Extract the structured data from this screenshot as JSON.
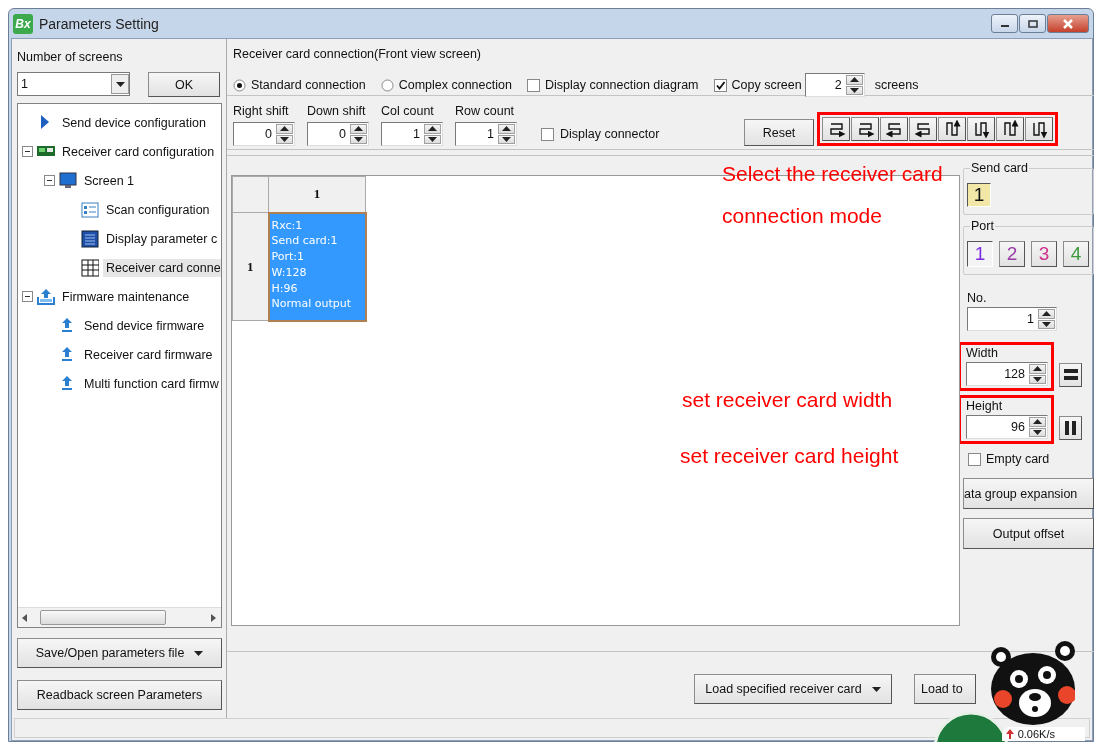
{
  "window": {
    "title": "Parameters Setting",
    "logo_text": "Bx"
  },
  "left_panel": {
    "screens_label": "Number of screens",
    "screens_value": "1",
    "ok_button": "OK",
    "tree": [
      {
        "kind": "send",
        "label": "Send device configuration",
        "selected": false
      },
      {
        "kind": "card",
        "label": "Receiver card configuration",
        "selected": false,
        "expanded": true,
        "children": [
          {
            "kind": "screen",
            "label": "Screen 1",
            "selected": false,
            "expanded": true,
            "children": [
              {
                "kind": "scan",
                "label": "Scan configuration",
                "selected": false
              },
              {
                "kind": "display",
                "label": "Display parameter c",
                "selected": false
              },
              {
                "kind": "grid",
                "label": "Receiver card conne",
                "selected": true
              }
            ]
          }
        ]
      },
      {
        "kind": "firmware",
        "label": "Firmware maintenance",
        "selected": false,
        "expanded": true,
        "children": [
          {
            "kind": "upload",
            "label": "Send device firmware",
            "selected": false
          },
          {
            "kind": "upload",
            "label": "Receiver card firmware",
            "selected": false
          },
          {
            "kind": "upload",
            "label": "Multi function card firmw",
            "selected": false
          }
        ]
      }
    ],
    "buttons": [
      {
        "label": "Save/Open parameters file",
        "dropdown": true
      },
      {
        "label": "Readback screen Parameters",
        "dropdown": false
      }
    ]
  },
  "connection": {
    "title": "Receiver card connection(Front view screen)",
    "modes": [
      {
        "label": "Standard connection",
        "selected": true
      },
      {
        "label": "Complex connection",
        "selected": false
      }
    ],
    "display_diagram": {
      "label": "Display connection diagram",
      "checked": false
    },
    "copy_screen": {
      "label": "Copy screen",
      "checked": true,
      "value": "2",
      "unit": "screens"
    }
  },
  "shift": {
    "fields": [
      {
        "label": "Right shift",
        "value": "0"
      },
      {
        "label": "Down shift",
        "value": "0"
      },
      {
        "label": "Col count",
        "value": "1"
      },
      {
        "label": "Row count",
        "value": "1"
      }
    ],
    "display_connector": {
      "label": "Display connector",
      "checked": false
    },
    "reset_button": "Reset"
  },
  "grid": {
    "columns": [
      "1"
    ],
    "rows": [
      {
        "header": "1",
        "cells": [
          {
            "selected": true,
            "lines": [
              "Rxc:1",
              "Send card:1",
              "Port:1",
              "W:128",
              "H:96",
              "Normal output"
            ]
          }
        ]
      }
    ]
  },
  "side": {
    "send_card": {
      "title": "Send card",
      "buttons": [
        {
          "label": "1",
          "selected": true
        }
      ]
    },
    "port": {
      "title": "Port",
      "buttons": [
        {
          "label": "1",
          "color": "#7a2ee0",
          "selected": true
        },
        {
          "label": "2",
          "color": "#9a3aa8",
          "selected": false
        },
        {
          "label": "3",
          "color": "#d0308c",
          "selected": false
        },
        {
          "label": "4",
          "color": "#3c9a3c",
          "selected": false
        }
      ]
    },
    "no": {
      "label": "No.",
      "value": "1"
    },
    "width": {
      "label": "Width",
      "value": "128"
    },
    "height": {
      "label": "Height",
      "value": "96"
    },
    "empty_card": {
      "label": "Empty card",
      "checked": false
    },
    "buttons": [
      "ata group expansion",
      "Output offset"
    ]
  },
  "bottom_buttons": [
    {
      "label": "Load specified receiver card",
      "dropdown": true
    },
    {
      "label": "Load to",
      "dropdown": false
    }
  ],
  "annotations": {
    "mode_note": [
      "Select the receiver card",
      "connection mode"
    ],
    "width_note": "set receiver card width",
    "height_note": "set receiver card height"
  },
  "widget": {
    "speed": "0.06K/s"
  }
}
